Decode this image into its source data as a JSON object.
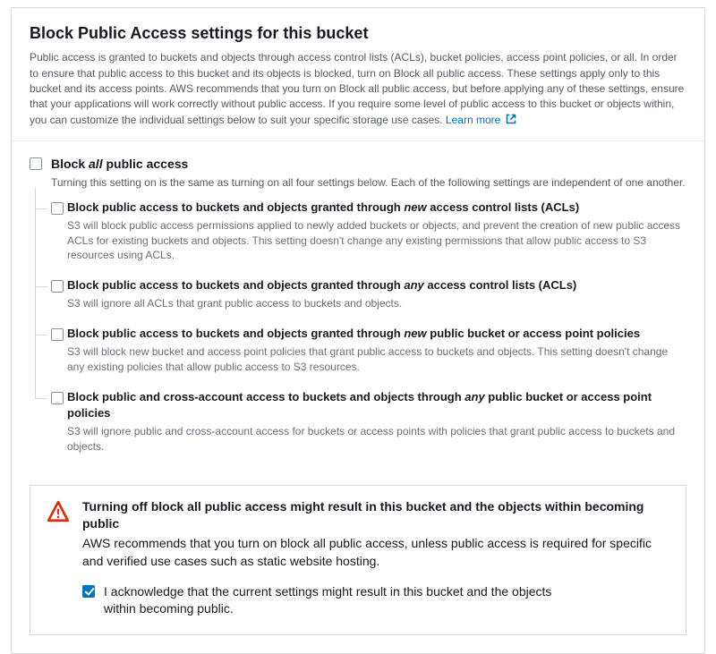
{
  "header": {
    "title": "Block Public Access settings for this bucket",
    "description": "Public access is granted to buckets and objects through access control lists (ACLs), bucket policies, access point policies, or all. In order to ensure that public access to this bucket and its objects is blocked, turn on Block all public access. These settings apply only to this bucket and its access points. AWS recommends that you turn on Block all public access, but before applying any of these settings, ensure that your applications will work correctly without public access. If you require some level of public access to this bucket or objects within, you can customize the individual settings below to suit your specific storage use cases.",
    "learn_more_label": "Learn more"
  },
  "master": {
    "label_pre": "Block ",
    "label_em": "all",
    "label_post": " public access",
    "sub": "Turning this setting on is the same as turning on all four settings below. Each of the following settings are independent of one another.",
    "checked": false
  },
  "options": [
    {
      "label_pre": "Block public access to buckets and objects granted through ",
      "label_em": "new",
      "label_post": " access control lists (ACLs)",
      "desc": "S3 will block public access permissions applied to newly added buckets or objects, and prevent the creation of new public access ACLs for existing buckets and objects. This setting doesn't change any existing permissions that allow public access to S3 resources using ACLs.",
      "checked": false
    },
    {
      "label_pre": "Block public access to buckets and objects granted through ",
      "label_em": "any",
      "label_post": " access control lists (ACLs)",
      "desc": "S3 will ignore all ACLs that grant public access to buckets and objects.",
      "checked": false
    },
    {
      "label_pre": "Block public access to buckets and objects granted through ",
      "label_em": "new",
      "label_post": " public bucket or access point policies",
      "desc": "S3 will block new bucket and access point policies that grant public access to buckets and objects. This setting doesn't change any existing policies that allow public access to S3 resources.",
      "checked": false
    },
    {
      "label_pre": "Block public and cross-account access to buckets and objects through ",
      "label_em": "any",
      "label_post": " public bucket or access point policies",
      "desc": "S3 will ignore public and cross-account access for buckets or access points with policies that grant public access to buckets and objects.",
      "checked": false
    }
  ],
  "warning": {
    "title": "Turning off block all public access might result in this bucket and the objects within becoming public",
    "text": "AWS recommends that you turn on block all public access, unless public access is required for specific and verified use cases such as static website hosting.",
    "ack_label": "I acknowledge that the current settings might result in this bucket and the objects within becoming public.",
    "ack_checked": true
  }
}
